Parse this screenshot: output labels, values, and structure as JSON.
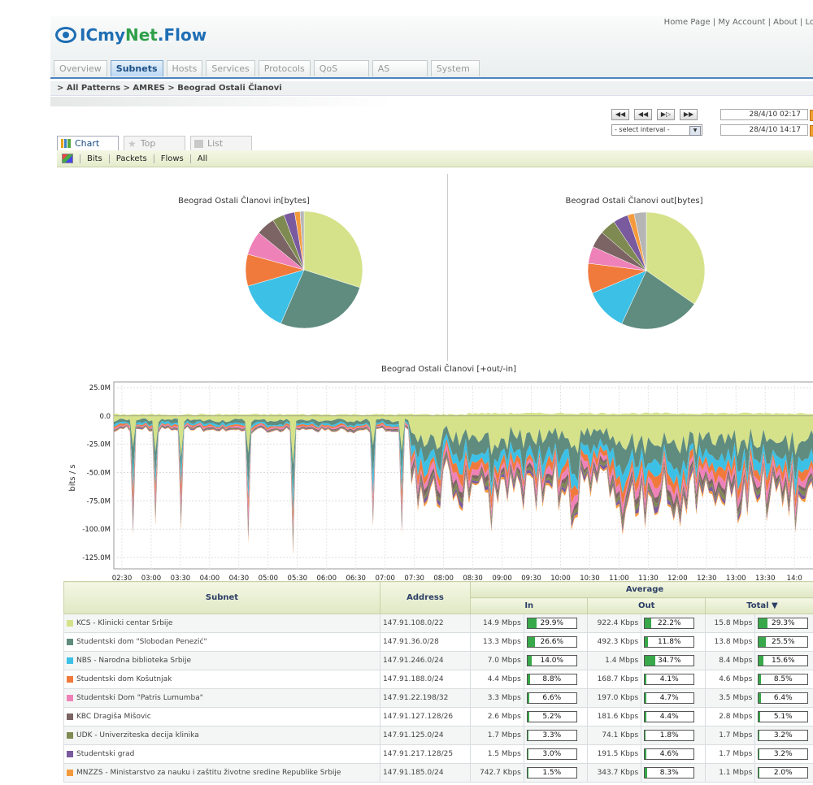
{
  "app": {
    "logo_prefix": "ICmy",
    "logo_net": "Net",
    "logo_suffix": ".Flow"
  },
  "toplinks": [
    "Home Page",
    "My Account",
    "About",
    "Lo"
  ],
  "tabs": [
    "Overview",
    "Subnets",
    "Hosts",
    "Services",
    "Protocols",
    "QoS",
    "AS",
    "System"
  ],
  "active_tab": "Subnets",
  "breadcrumb": "> All Patterns > AMRES > Beograd Ostali Članovi",
  "nav_buttons": [
    "◀◀",
    "◀◀",
    "▶▷",
    "▶▶"
  ],
  "date_from": "28/4/10 02:17",
  "date_to": "28/4/10 14:17",
  "interval_placeholder": "- select interval -",
  "view_tabs": {
    "chart": "Chart",
    "top": "Top",
    "list": "List"
  },
  "type_bar": [
    "Bits",
    "Packets",
    "Flows",
    "All"
  ],
  "pie_in": {
    "title": "Beograd Ostali Članovi in[bytes]",
    "slices": [
      29.9,
      26.6,
      14.0,
      8.8,
      6.6,
      5.2,
      3.3,
      3.0,
      1.5,
      1.1
    ]
  },
  "pie_out": {
    "title": "Beograd Ostali Članovi out[bytes]",
    "slices": [
      34.7,
      22.2,
      11.8,
      8.3,
      4.7,
      4.6,
      4.4,
      4.1,
      1.8,
      3.4
    ]
  },
  "colors": [
    "#d6e28a",
    "#5f8c7e",
    "#3cc0e6",
    "#f07a3c",
    "#ee82b8",
    "#7c6464",
    "#7e8a52",
    "#7a5a9e",
    "#f59a3c",
    "#b5b5b5",
    "#1a66c0"
  ],
  "chart_data": {
    "type": "area",
    "title": "Beograd Ostali Članovi [+out/-in]",
    "ylabel": "bits / s",
    "ylim": [
      -135,
      30
    ],
    "y_ticks": [
      "25.0M",
      "0.0",
      "-25.0M",
      "-50.0M",
      "-75.0M",
      "-100.0M",
      "-125.0M"
    ],
    "x_ticks": [
      "02:30",
      "03:00",
      "03:30",
      "04:00",
      "04:30",
      "05:00",
      "05:30",
      "06:00",
      "06:30",
      "07:00",
      "07:30",
      "08:00",
      "08:30",
      "09:00",
      "09:30",
      "10:00",
      "10:30",
      "11:00",
      "11:30",
      "12:00",
      "12:30",
      "13:00",
      "13:30",
      "14:0"
    ],
    "grid": true
  },
  "table": {
    "headers": {
      "subnet": "Subnet",
      "address": "Address",
      "average": "Average",
      "in": "In",
      "out": "Out",
      "total": "Total ▼"
    },
    "rows": [
      {
        "name": "KCS - Klinicki centar Srbije",
        "address": "147.91.108.0/22",
        "in": "14.9 Mbps",
        "in_pct": "29.9%",
        "out": "922.4 Kbps",
        "out_pct": "22.2%",
        "total": "15.8 Mbps",
        "total_pct": "29.3%"
      },
      {
        "name": "Studentski dom \"Slobodan Penezić\"",
        "address": "147.91.36.0/28",
        "in": "13.3 Mbps",
        "in_pct": "26.6%",
        "out": "492.3 Kbps",
        "out_pct": "11.8%",
        "total": "13.8 Mbps",
        "total_pct": "25.5%"
      },
      {
        "name": "NBS - Narodna biblioteka Srbije",
        "address": "147.91.246.0/24",
        "in": "7.0 Mbps",
        "in_pct": "14.0%",
        "out": "1.4 Mbps",
        "out_pct": "34.7%",
        "total": "8.4 Mbps",
        "total_pct": "15.6%"
      },
      {
        "name": "Studentski dom Košutnjak",
        "address": "147.91.188.0/24",
        "in": "4.4 Mbps",
        "in_pct": "8.8%",
        "out": "168.7 Kbps",
        "out_pct": "4.1%",
        "total": "4.6 Mbps",
        "total_pct": "8.5%"
      },
      {
        "name": "Studentski Dom \"Patris Lumumba\"",
        "address": "147.91.22.198/32",
        "in": "3.3 Mbps",
        "in_pct": "6.6%",
        "out": "197.0 Kbps",
        "out_pct": "4.7%",
        "total": "3.5 Mbps",
        "total_pct": "6.4%"
      },
      {
        "name": "KBC Dragiša Mišovic",
        "address": "147.91.127.128/26",
        "in": "2.6 Mbps",
        "in_pct": "5.2%",
        "out": "181.6 Kbps",
        "out_pct": "4.4%",
        "total": "2.8 Mbps",
        "total_pct": "5.1%"
      },
      {
        "name": "UDK - Univerziteska decija klinika",
        "address": "147.91.125.0/24",
        "in": "1.7 Mbps",
        "in_pct": "3.3%",
        "out": "74.1 Kbps",
        "out_pct": "1.8%",
        "total": "1.7 Mbps",
        "total_pct": "3.2%"
      },
      {
        "name": "Studentski grad",
        "address": "147.91.217.128/25",
        "in": "1.5 Mbps",
        "in_pct": "3.0%",
        "out": "191.5 Kbps",
        "out_pct": "4.6%",
        "total": "1.7 Mbps",
        "total_pct": "3.2%"
      },
      {
        "name": "MNZZS - Ministarstvo za nauku i zaštitu životne sredine Republike Srbije",
        "address": "147.91.185.0/24",
        "in": "742.7 Kbps",
        "in_pct": "1.5%",
        "out": "343.7 Kbps",
        "out_pct": "8.3%",
        "total": "1.1 Mbps",
        "total_pct": "2.0%"
      }
    ]
  }
}
